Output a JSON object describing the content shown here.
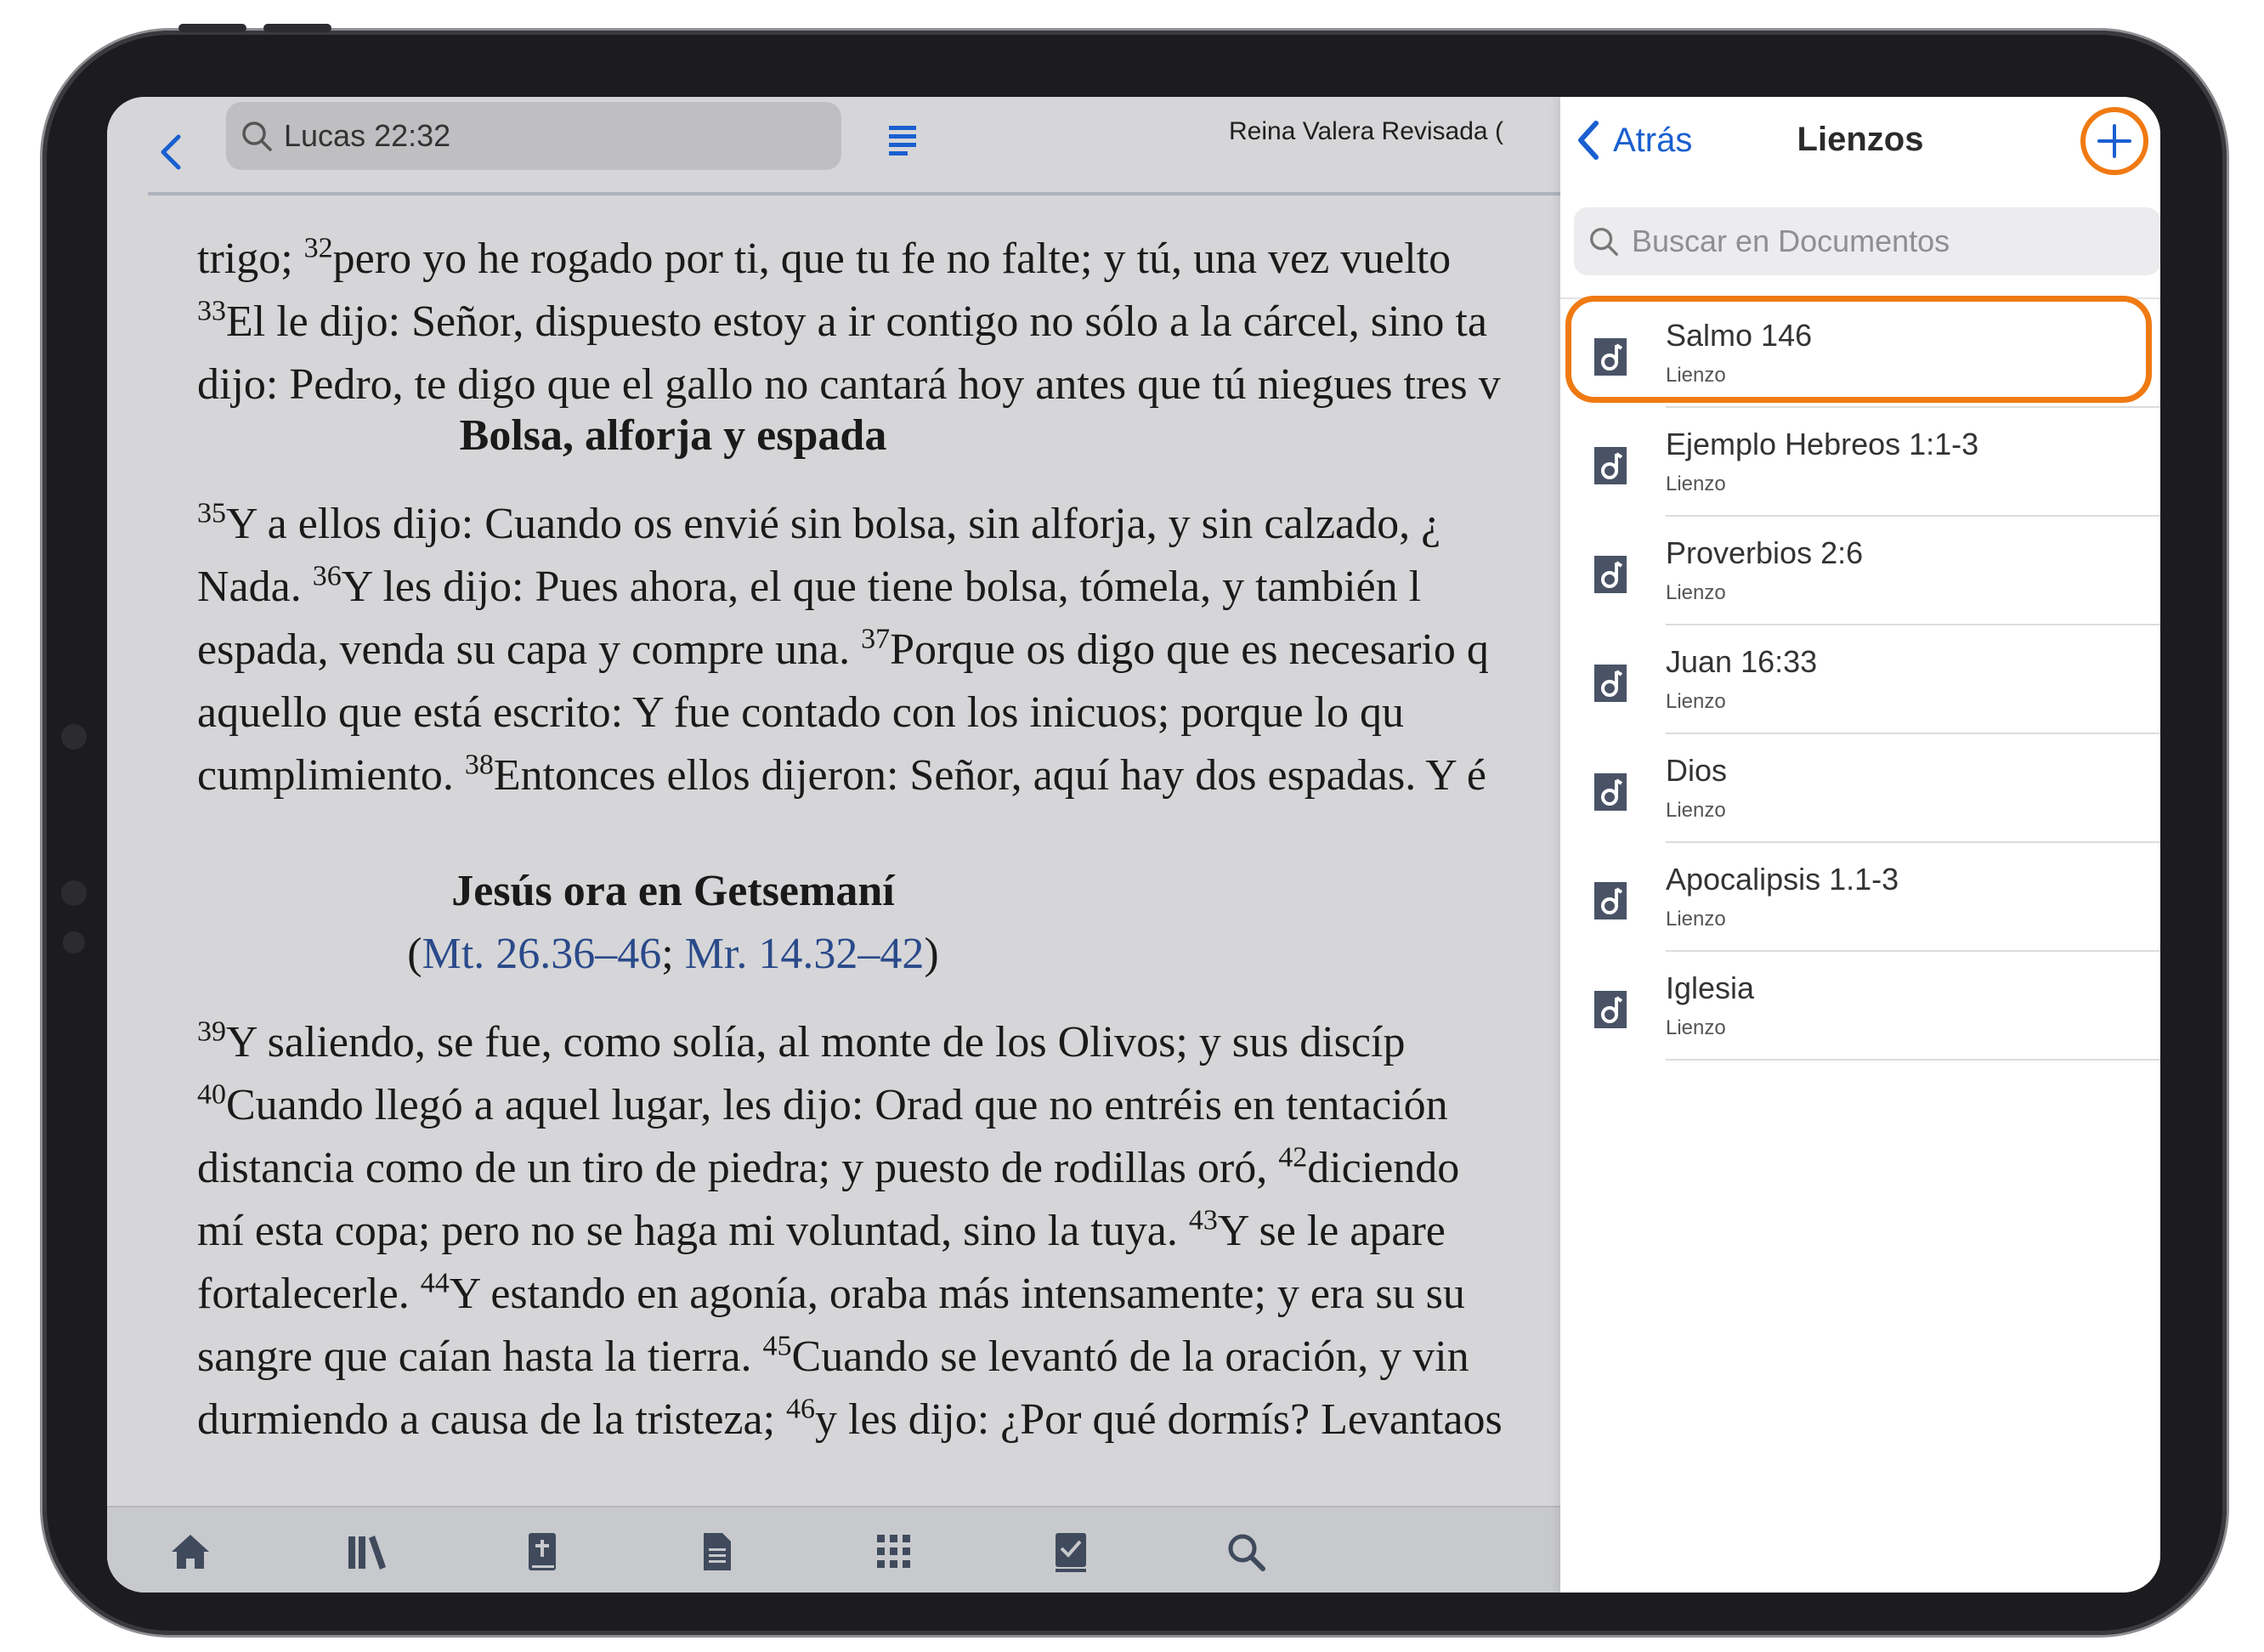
{
  "reader": {
    "search_value": "Lucas 22:32",
    "version_label": "Reina Valera Revisada (",
    "lines_top": [
      {
        "pre": "trigo; ",
        "sup": "32",
        "text": "pero yo he rogado por ti, que tu fe no falte; y tú, una vez vuelto"
      },
      {
        "pre": "",
        "sup": "33",
        "text": "El le dijo: Señor, dispuesto estoy a ir contigo no sólo a la cárcel, sino ta"
      },
      {
        "pre": "dijo: Pedro, te digo que el gallo no cantará hoy antes que tú niegues tres v",
        "sup": "",
        "text": ""
      }
    ],
    "heading_1": "Bolsa, alforja y espada",
    "lines_mid": [
      {
        "pre": " ",
        "sup": "35",
        "text": "Y a ellos dijo: Cuando os envié sin bolsa, sin alforja, y sin calzado, ¿"
      },
      {
        "pre": "Nada. ",
        "sup": "36",
        "text": "Y les dijo: Pues ahora, el que tiene bolsa, tómela, y también l"
      },
      {
        "pre": "espada, venda su capa y compre una. ",
        "sup": "37",
        "text": "Porque os digo que es necesario q"
      },
      {
        "pre": "aquello que está escrito: Y fue contado con los inicuos; porque lo qu",
        "sup": "",
        "text": ""
      },
      {
        "pre": "cumplimiento. ",
        "sup": "38",
        "text": "Entonces ellos dijeron: Señor, aquí hay dos espadas. Y é"
      }
    ],
    "heading_2": "Jesús ora en Getsemaní",
    "ref_open": "(",
    "ref_1": "Mt. 26.36–46",
    "ref_sep": "; ",
    "ref_2": "Mr. 14.32–42",
    "ref_close": ")",
    "lines_bottom": [
      {
        "pre": " ",
        "sup": "39",
        "text": "Y saliendo, se fue, como solía, al monte de los Olivos; y sus discíp"
      },
      {
        "pre": "",
        "sup": "40",
        "text": "Cuando llegó a aquel lugar, les dijo: Orad que no entréis en tentación"
      },
      {
        "pre": "distancia como de un tiro de piedra; y puesto de rodillas oró, ",
        "sup": "42",
        "text": "diciendo"
      },
      {
        "pre": "mí esta copa; pero no se haga mi voluntad, sino la tuya. ",
        "sup": "43",
        "text": "Y se le apare"
      },
      {
        "pre": "fortalecerle. ",
        "sup": "44",
        "text": "Y estando en agonía, oraba más intensamente; y era su su"
      },
      {
        "pre": "sangre que caían hasta la tierra. ",
        "sup": "45",
        "text": "Cuando se levantó de la oración, y vin"
      },
      {
        "pre": "durmiendo a causa de la tristeza; ",
        "sup": "46",
        "text": "y les dijo: ¿Por qué dormís? Levantaos"
      }
    ]
  },
  "tabbar": {
    "icons": [
      "home-icon",
      "library-icon",
      "bible-icon",
      "document-icon",
      "apps-grid-icon",
      "checklist-icon",
      "search-icon"
    ]
  },
  "panel": {
    "back_label": "Atrás",
    "title": "Lienzos",
    "search_placeholder": "Buscar en Documentos",
    "items": [
      {
        "name": "Salmo 146",
        "type": "Lienzo"
      },
      {
        "name": "Ejemplo Hebreos 1:1-3",
        "type": "Lienzo"
      },
      {
        "name": "Proverbios 2:6",
        "type": "Lienzo"
      },
      {
        "name": "Juan 16:33",
        "type": "Lienzo"
      },
      {
        "name": "Dios",
        "type": "Lienzo"
      },
      {
        "name": "Apocalipsis 1.1-3",
        "type": "Lienzo"
      },
      {
        "name": "Iglesia",
        "type": "Lienzo"
      }
    ]
  },
  "colors": {
    "accent_blue": "#1a5fd0",
    "highlight_orange": "#f07a12",
    "link_blue": "#2a4a8a"
  }
}
